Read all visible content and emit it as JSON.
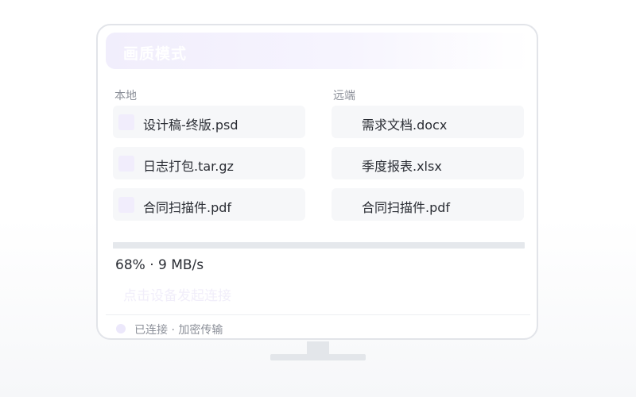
{
  "header": {
    "title": "画质模式"
  },
  "local": {
    "label": "本地",
    "files": [
      {
        "name": "设计稿-终版.psd",
        "icon": "file-icon"
      },
      {
        "name": "日志打包.tar.gz",
        "icon": "file-icon"
      },
      {
        "name": "合同扫描件.pdf",
        "icon": "file-icon"
      }
    ]
  },
  "remote": {
    "label": "远端",
    "files": [
      {
        "name": "需求文档.docx"
      },
      {
        "name": "季度报表.xlsx"
      },
      {
        "name": "合同扫描件.pdf"
      }
    ]
  },
  "transfer": {
    "status_text": "68% · 9 MB/s",
    "progress_percent": 68
  },
  "connect_button_label": "点击设备发起连接",
  "status_bar": {
    "text": "已连接 · 加密传输"
  },
  "colors": {
    "accent_light": "#f1edfc",
    "item_bg": "#f6f7f9",
    "track": "#e5e8ec"
  }
}
